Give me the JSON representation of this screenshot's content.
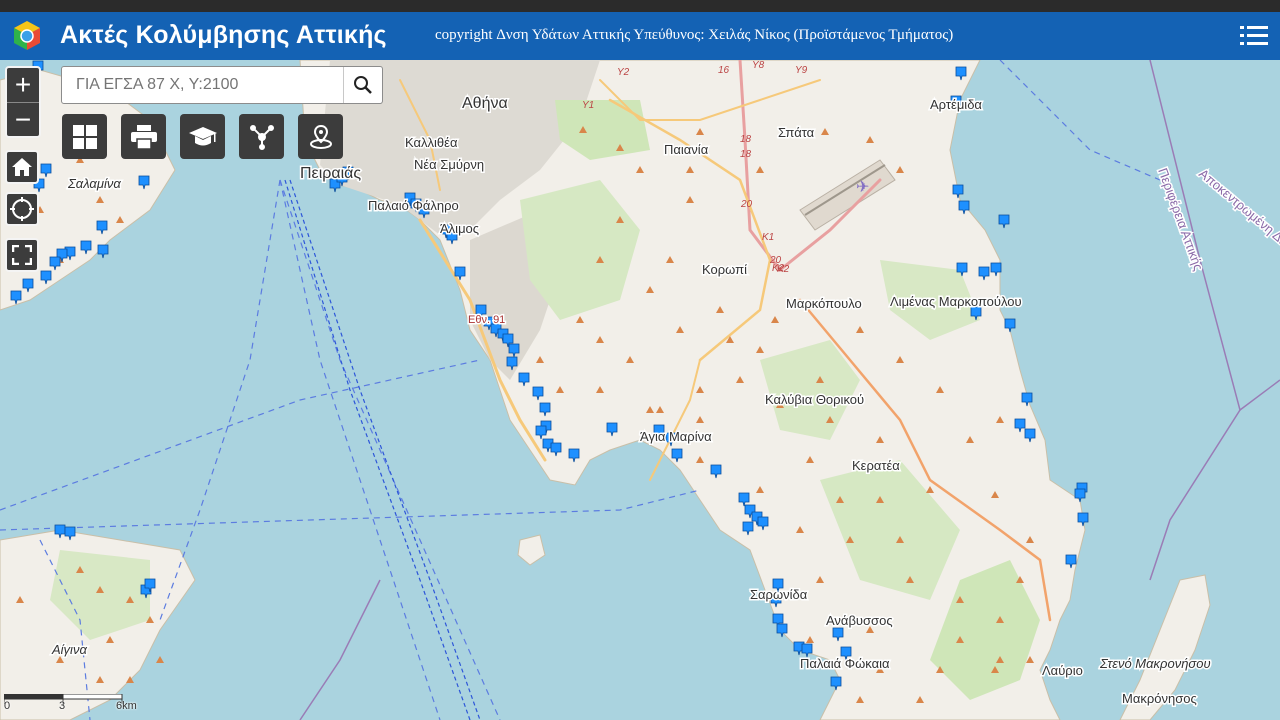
{
  "header": {
    "title": "Ακτές Κολύμβησης Αττικής",
    "copyright": "copyright Δνση Υδάτων Αττικής Υπεύθυνος: Χειλάς Νίκος (Προϊστάμενος Τμήματος)"
  },
  "search": {
    "placeholder": "ΓΙΑ ΕΓΣΑ 87 Χ, Υ:2100"
  },
  "zoom": {
    "in": "+",
    "out": "−"
  },
  "toolbar": [
    "basemap-gallery",
    "print",
    "legend",
    "measure",
    "location"
  ],
  "colors": {
    "header": "#1462b4",
    "sea": "#aad3df",
    "land": "#f2efe9",
    "marker": "#1e90ff",
    "peak": "#d9864a"
  },
  "map_labels": [
    {
      "text": "Αθήνα",
      "big": true
    },
    {
      "text": "Καλλιθέα"
    },
    {
      "text": "Νέα Σμύρνη"
    },
    {
      "text": "Πειραιάς",
      "big": true
    },
    {
      "text": "Παλαιό Φάληρο"
    },
    {
      "text": "Άλιμος"
    },
    {
      "text": "Σαλαμίνα",
      "italic": true
    },
    {
      "text": "Παιανία"
    },
    {
      "text": "Σπάτα"
    },
    {
      "text": "Αρτέμιδα"
    },
    {
      "text": "Κορωπί"
    },
    {
      "text": "Μαρκόπουλο"
    },
    {
      "text": "Λιμένας Μαρκοπούλου"
    },
    {
      "text": "Καλύβια Θορικού"
    },
    {
      "text": "Άγια Μαρίνα"
    },
    {
      "text": "Κερατέα"
    },
    {
      "text": "Σαρωνίδα"
    },
    {
      "text": "Ανάβυσσος"
    },
    {
      "text": "Παλαιά Φώκαια"
    },
    {
      "text": "Λαύριο"
    },
    {
      "text": "Μακρόνησος"
    },
    {
      "text": "Στενό Μακρονήσου",
      "italic": true
    },
    {
      "text": "Αίγινα",
      "italic": true
    },
    {
      "text": "Περιφέρεια Αττικής"
    },
    {
      "text": "Αποκεντρωμένη Διοίκηση"
    },
    {
      "text": "Εθν. 91"
    }
  ],
  "road_labels": [
    "Y2",
    "Y1",
    "Y8",
    "Y9",
    "16",
    "18",
    "18",
    "20",
    "20",
    "K1",
    "K2",
    "K2"
  ],
  "scale": {
    "labels": [
      "0",
      "3",
      "6km"
    ]
  }
}
